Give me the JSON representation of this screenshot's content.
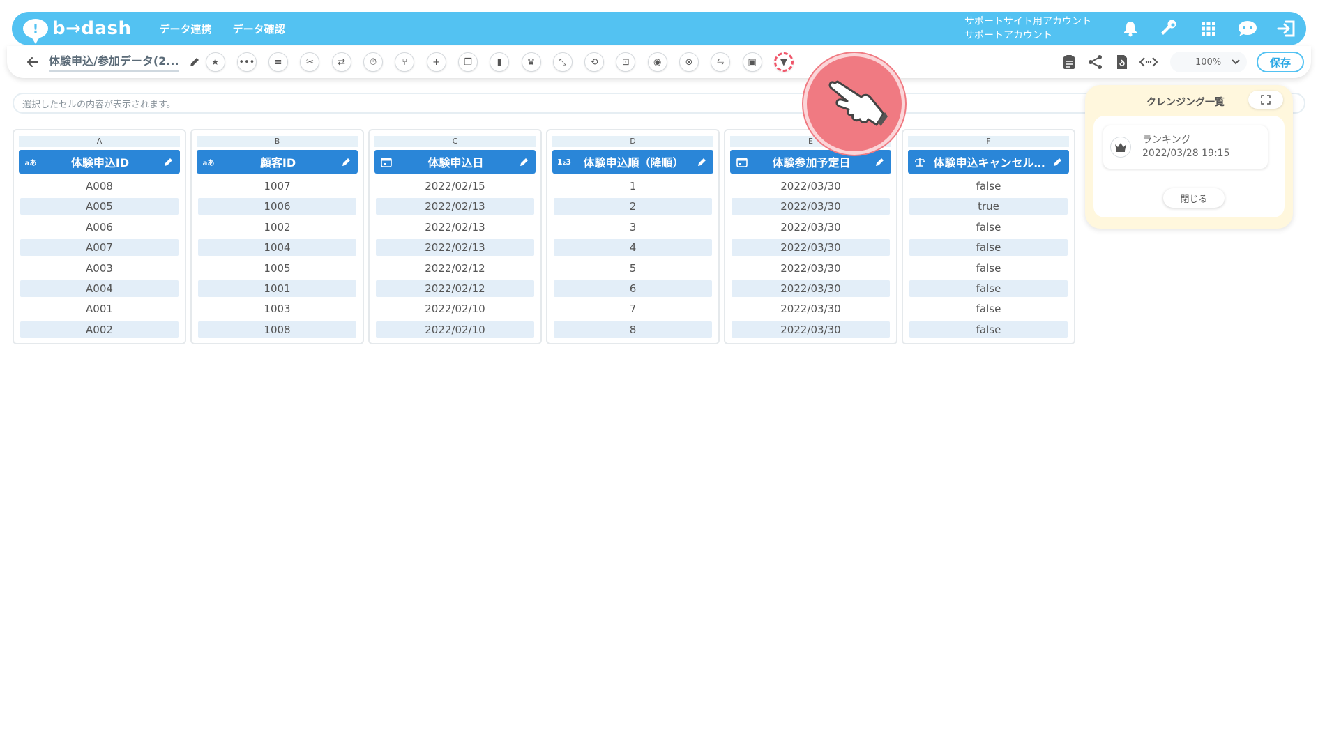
{
  "header": {
    "logo_mark": "!",
    "logo_text": "b→dash",
    "nav": [
      "データ連携",
      "データ確認"
    ],
    "account_line1": "サポートサイト用アカウント",
    "account_line2": "サポートアカウント",
    "icons": [
      "bell-icon",
      "wrench-icon",
      "grid-icon",
      "chat-icon",
      "logout-icon"
    ],
    "color": "#53c2f2"
  },
  "toolbar": {
    "title": "体験申込/参加データ(2...",
    "tools": [
      {
        "name": "star",
        "glyph": "★"
      },
      {
        "name": "dots",
        "glyph": "•••"
      },
      {
        "name": "list",
        "glyph": "≡"
      },
      {
        "name": "cut",
        "glyph": "✂"
      },
      {
        "name": "shuffle",
        "glyph": "⇄"
      },
      {
        "name": "timer",
        "glyph": "⏱"
      },
      {
        "name": "merge",
        "glyph": "⑂"
      },
      {
        "name": "plus",
        "glyph": "+"
      },
      {
        "name": "copy",
        "glyph": "❐"
      },
      {
        "name": "trash",
        "glyph": "▮"
      },
      {
        "name": "crown",
        "glyph": "♛"
      },
      {
        "name": "collapse",
        "glyph": "⤡"
      },
      {
        "name": "repeat",
        "glyph": "⟲"
      },
      {
        "name": "lock",
        "glyph": "⊡"
      },
      {
        "name": "box",
        "glyph": "◉"
      },
      {
        "name": "cancel",
        "glyph": "⊗"
      },
      {
        "name": "translate",
        "glyph": "⇋"
      },
      {
        "name": "square",
        "glyph": "▣"
      },
      {
        "name": "filter",
        "glyph": "▼"
      }
    ],
    "zoom": "100%",
    "save_label": "保存"
  },
  "cellbar": {
    "placeholder": "選択したセルの内容が表示されます。"
  },
  "grid": {
    "columns": [
      {
        "letter": "A",
        "type": "aあ",
        "name": "体験申込ID",
        "values": [
          "A008",
          "A005",
          "A006",
          "A007",
          "A003",
          "A004",
          "A001",
          "A002"
        ]
      },
      {
        "letter": "B",
        "type": "aあ",
        "name": "顧客ID",
        "values": [
          "1007",
          "1006",
          "1002",
          "1004",
          "1005",
          "1001",
          "1003",
          "1008"
        ]
      },
      {
        "letter": "C",
        "type": "cal",
        "name": "体験申込日",
        "values": [
          "2022/02/15",
          "2022/02/13",
          "2022/02/13",
          "2022/02/13",
          "2022/02/12",
          "2022/02/12",
          "2022/02/10",
          "2022/02/10"
        ]
      },
      {
        "letter": "D",
        "type": "1₂3",
        "name": "体験申込順（降順）",
        "values": [
          "1",
          "2",
          "3",
          "4",
          "5",
          "6",
          "7",
          "8"
        ]
      },
      {
        "letter": "E",
        "type": "cal",
        "name": "体験参加予定日",
        "values": [
          "2022/03/30",
          "2022/03/30",
          "2022/03/30",
          "2022/03/30",
          "2022/03/30",
          "2022/03/30",
          "2022/03/30",
          "2022/03/30"
        ]
      },
      {
        "letter": "F",
        "type": "bool",
        "name": "体験申込キャンセル…",
        "values": [
          "false",
          "true",
          "false",
          "false",
          "false",
          "false",
          "false",
          "false"
        ]
      }
    ],
    "header_color": "#2a86d8"
  },
  "panel": {
    "title": "クレンジング一覧",
    "item_name": "ランキング",
    "item_date": "2022/03/28 19:15",
    "close_label": "閉じる",
    "bg_color": "#fff7dd"
  }
}
